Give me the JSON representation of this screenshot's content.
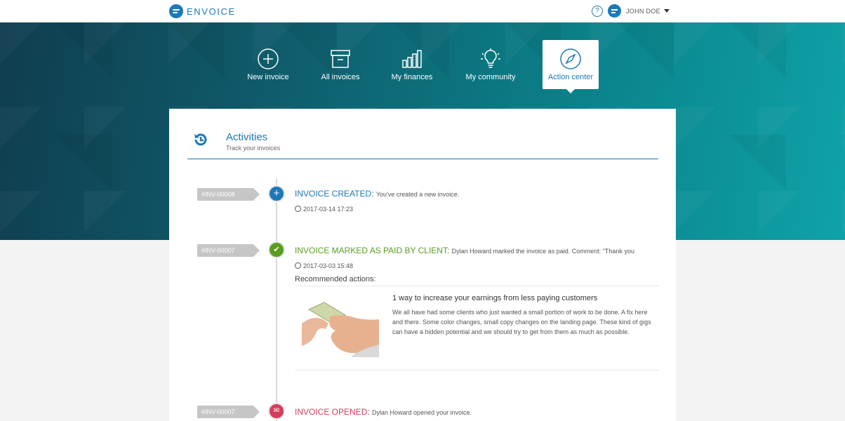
{
  "header": {
    "brand": "ENVOICE",
    "help": "?",
    "user_name": "JOHN DOE"
  },
  "nav": [
    {
      "label": "New invoice",
      "icon": "plus-circle-icon"
    },
    {
      "label": "All invoices",
      "icon": "archive-box-icon"
    },
    {
      "label": "My finances",
      "icon": "bar-chart-icon"
    },
    {
      "label": "My community",
      "icon": "lightbulb-icon"
    },
    {
      "label": "Action center",
      "icon": "compass-icon",
      "active": true
    }
  ],
  "activities": {
    "title": "Activities",
    "subtitle": "Track your invoices"
  },
  "events": [
    {
      "invoice": "#INV-00008",
      "label": "INVOICE CREATED:",
      "detail": "You've created a new invoice.",
      "time": "2017-03-14 17:23",
      "color": "#1c78b8",
      "icon": "plus-icon"
    },
    {
      "invoice": "#INV-00007",
      "label": "INVOICE MARKED AS PAID BY CLIENT:",
      "detail": "Dylan Howard marked the invoice as paid. Comment: \"Thank you",
      "time": "2017-03-03 15:48",
      "color": "#5a9e1f",
      "icon": "check-icon"
    },
    {
      "invoice": "#INV-00007",
      "label": "INVOICE OPENED:",
      "detail": "Dylan Howard opened your invoice.",
      "color": "#d33d5b",
      "icon": "envelope-open-icon"
    }
  ],
  "recommended": {
    "title": "Recommended actions:",
    "article_title": "1 way to increase your earnings from less paying customers",
    "article_body": "We all have had some clients who just wanted a small portion of work to be done. A fix here and there. Some color changes, small copy changes on the landing page. These kind of gigs can have a hidden potential and we should try to get from them as much as possible."
  }
}
